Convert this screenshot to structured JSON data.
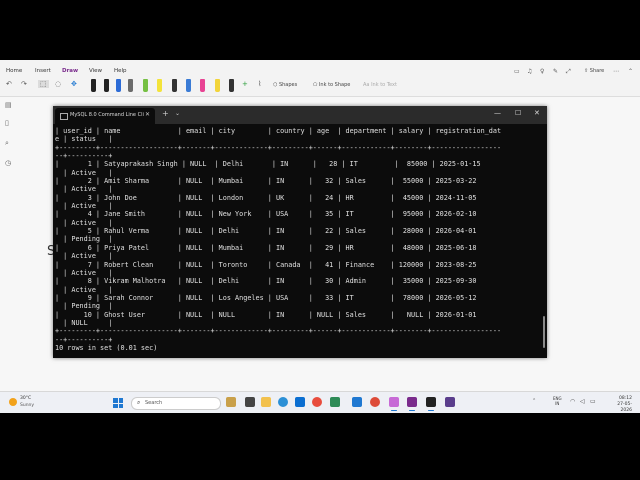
{
  "ribbon": {
    "tabs": [
      "Home",
      "Insert",
      "Draw",
      "View",
      "Help"
    ],
    "active_tab": "Draw",
    "shapes_label": "Shapes",
    "ink_to_shape_label": "Ink to Shape",
    "ink_to_text_label": "Ink to Text",
    "share_label": "Share"
  },
  "canvas": {
    "glyph": "S"
  },
  "terminal": {
    "tab_title": "MySQL 8.0 Command Line Cli",
    "output": [
      "| user_id | name              | email | city        | country | age  | department | salary | registration_dat",
      "e | status   |",
      "+---------+-------------------+-------+-------------+---------+------+------------+--------+-----------------",
      "--+----------+",
      "|       1 | Satyaprakash Singh | NULL  | Delhi       | IN      |   28 | IT         |  85000 | 2025-01-15",
      "  | Active   |",
      "|       2 | Amit Sharma       | NULL  | Mumbai      | IN      |   32 | Sales      |  55000 | 2025-03-22",
      "  | Active   |",
      "|       3 | John Doe          | NULL  | London      | UK      |   24 | HR         |  45000 | 2024-11-05",
      "  | Active   |",
      "|       4 | Jane Smith        | NULL  | New York    | USA     |   35 | IT         |  95000 | 2026-02-10",
      "  | Active   |",
      "|       5 | Rahul Verma       | NULL  | Delhi       | IN      |   22 | Sales      |  28000 | 2026-04-01",
      "  | Pending  |",
      "|       6 | Priya Patel       | NULL  | Mumbai      | IN      |   29 | HR         |  48000 | 2025-06-18",
      "  | Active   |",
      "|       7 | Robert Clean      | NULL  | Toronto     | Canada  |   41 | Finance    | 120000 | 2023-08-25",
      "  | Active   |",
      "|       8 | Vikram Malhotra   | NULL  | Delhi       | IN      |   30 | Admin      |  35000 | 2025-09-30",
      "  | Active   |",
      "|       9 | Sarah Connor      | NULL  | Los Angeles | USA     |   33 | IT         |  78000 | 2026-05-12",
      "  | Pending  |",
      "|      10 | Ghost User        | NULL  | NULL        | IN      | NULL | Sales      |   NULL | 2026-01-01",
      "  | NULL     |",
      "+---------+-------------------+-------+-------------+---------+------+------------+--------+-----------------",
      "--+----------+",
      "10 rows in set (0.01 sec)",
      "",
      ""
    ]
  },
  "taskbar": {
    "weather_temp": "30°C",
    "weather_desc": "Sunny",
    "search_label": "Search",
    "lang_line1": "ENG",
    "lang_line2": "IN",
    "time": "08:12",
    "date": "27-05-2026"
  },
  "colors": {
    "accent": "#7a2b8c",
    "terminal_bg": "#0c0c0c",
    "terminal_fg": "#e0e0e0",
    "taskbar_bg": "#eef0f5"
  }
}
